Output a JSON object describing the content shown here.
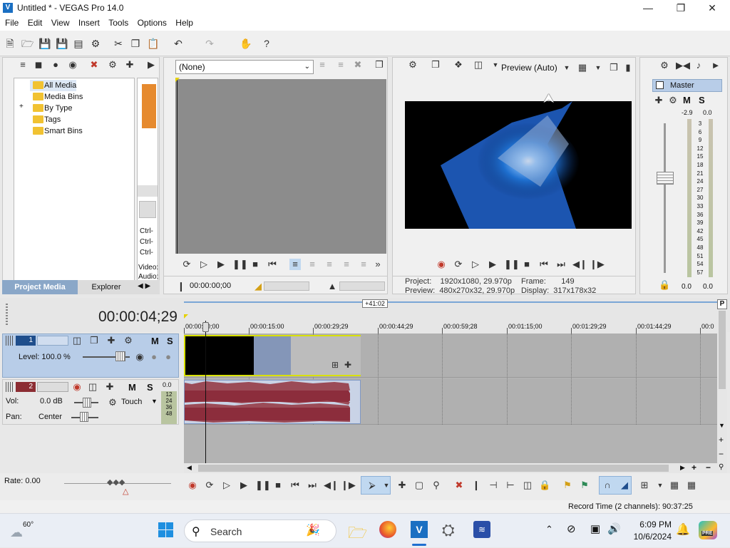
{
  "window": {
    "title": "Untitled * - VEGAS Pro 14.0"
  },
  "menu": [
    "File",
    "Edit",
    "View",
    "Insert",
    "Tools",
    "Options",
    "Help"
  ],
  "project_media": {
    "tree": [
      "All Media",
      "Media Bins",
      "By Type",
      "Tags",
      "Smart Bins"
    ],
    "tabs": [
      "Project Media",
      "Explorer"
    ],
    "thumb_texts": [
      "Ctrl-",
      "Ctrl-",
      "Ctrl-",
      "Video:",
      "Audio:"
    ]
  },
  "trimmer": {
    "dropdown": "(None)",
    "timecode": "00:00:00;00"
  },
  "preview": {
    "mode": "Preview (Auto)",
    "project_label": "Project:",
    "project_value": "1920x1080, 29.970p",
    "preview_label": "Preview:",
    "preview_value": "480x270x32, 29.970p",
    "frame_label": "Frame:",
    "frame_value": "149",
    "display_label": "Display:",
    "display_value": "317x178x32"
  },
  "master": {
    "label": "Master",
    "meter_top_left": "-2.9",
    "meter_top_right": "0.0",
    "scale": [
      "3",
      "6",
      "9",
      "12",
      "15",
      "18",
      "21",
      "24",
      "27",
      "30",
      "33",
      "36",
      "39",
      "42",
      "45",
      "48",
      "51",
      "54",
      "57"
    ],
    "bottom_left": "0.0",
    "bottom_right": "0.0"
  },
  "timeline": {
    "timecode": "00:00:04;29",
    "loop_label": "+41:02",
    "ruler": [
      "00:00:00;00",
      "00:00:15:00",
      "00:00:29;29",
      "00:00:44;29",
      "00:00:59;28",
      "00:01:15;00",
      "00:01:29;29",
      "00:01:44;29",
      "00:0"
    ]
  },
  "tracks": {
    "video": {
      "number": "1",
      "level": "Level: 100.0 %",
      "m": "M",
      "s": "S"
    },
    "audio": {
      "number": "2",
      "vol_label": "Vol:",
      "vol_value": "0.0 dB",
      "pan_label": "Pan:",
      "pan_value": "Center",
      "touch": "Touch",
      "m": "M",
      "s": "S",
      "meter": [
        "0.0",
        "12",
        "24",
        "36",
        "48"
      ]
    }
  },
  "transport": {
    "rate": "Rate: 0.00"
  },
  "status": {
    "record_time": "Record Time (2 channels): 90:37:25"
  },
  "taskbar": {
    "weather": "60°",
    "search": "Search",
    "time": "6:09 PM",
    "date": "10/6/2024",
    "badge": "PRE"
  }
}
